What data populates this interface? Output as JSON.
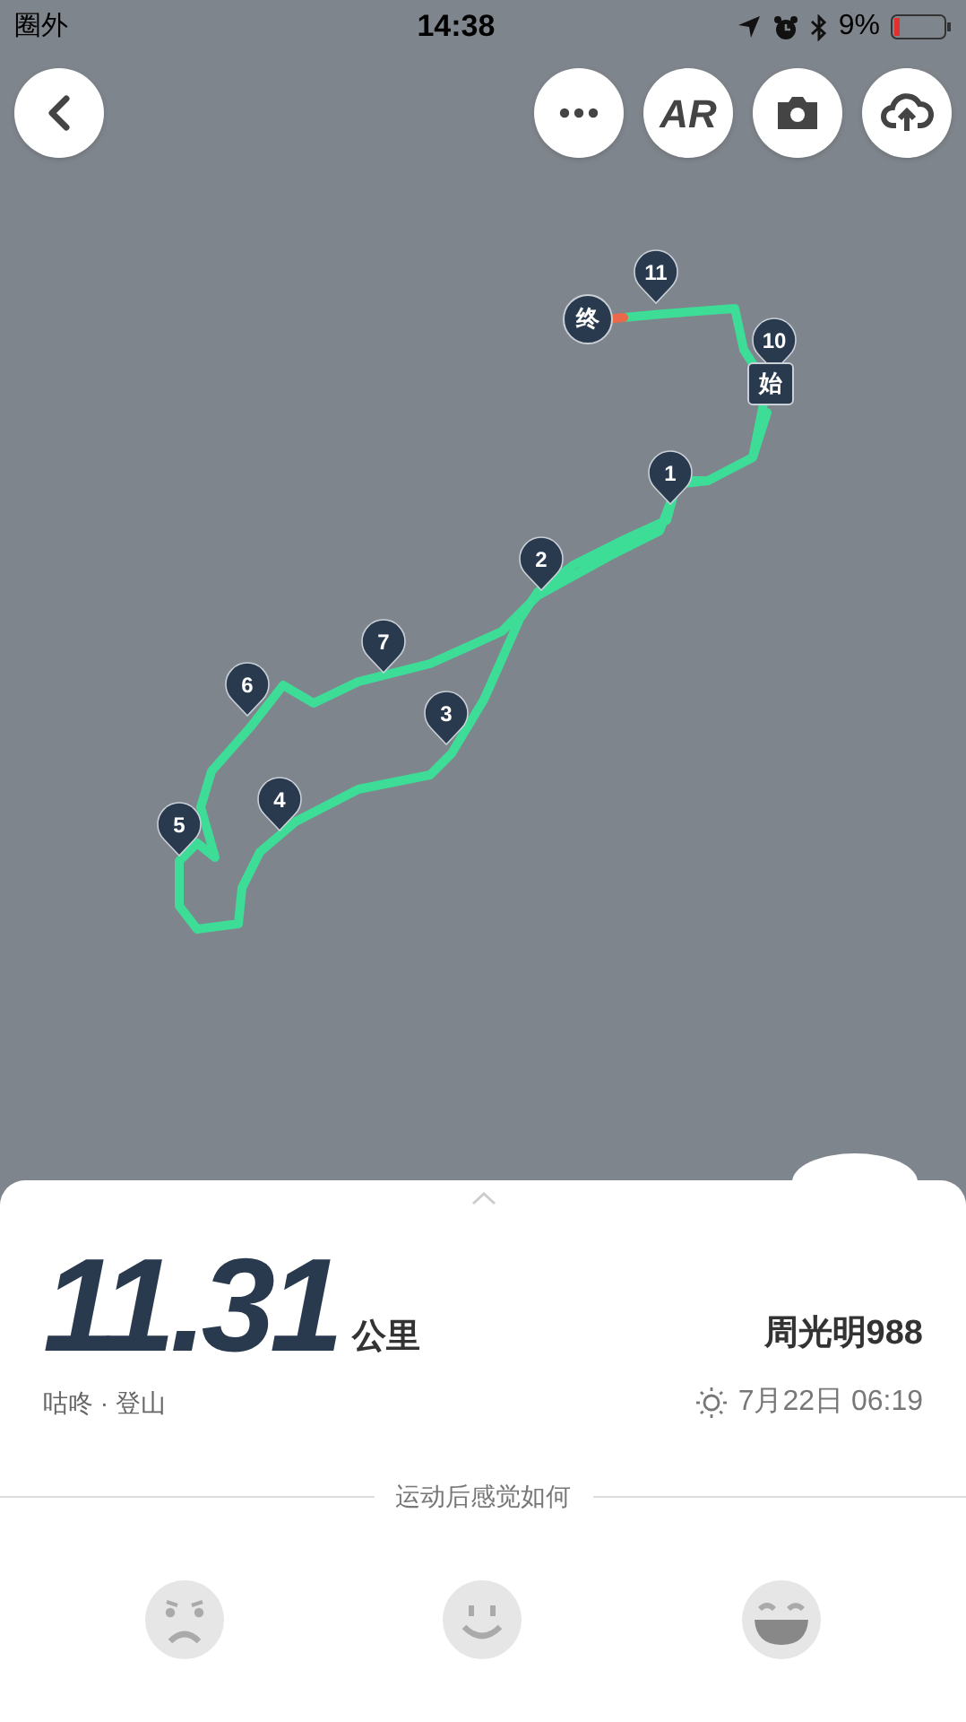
{
  "status_bar": {
    "carrier": "圈外",
    "time": "14:38",
    "battery": "9%"
  },
  "toolbar": {
    "buttons": [
      {
        "kind": "more"
      },
      {
        "kind": "ar",
        "label": "AR"
      },
      {
        "kind": "camera"
      },
      {
        "kind": "upload"
      }
    ]
  },
  "map": {
    "markers": [
      {
        "kind": "km",
        "label": "1"
      },
      {
        "kind": "km",
        "label": "2"
      },
      {
        "kind": "km",
        "label": "3"
      },
      {
        "kind": "km",
        "label": "4"
      },
      {
        "kind": "km",
        "label": "5"
      },
      {
        "kind": "km",
        "label": "6"
      },
      {
        "kind": "km",
        "label": "7"
      },
      {
        "kind": "km",
        "label": "10"
      },
      {
        "kind": "km",
        "label": "11"
      },
      {
        "kind": "start",
        "label": "始"
      },
      {
        "kind": "end",
        "label": "终"
      }
    ]
  },
  "summary": {
    "distance": "11.31",
    "unit": "公里",
    "source": "咕咚 · 登山",
    "user": "周光明988",
    "date": "7月22日 06:19"
  },
  "feedback": {
    "prompt": "运动后感觉如何",
    "moods": [
      {
        "kind": "sad"
      },
      {
        "kind": "smile"
      },
      {
        "kind": "laugh"
      }
    ]
  }
}
